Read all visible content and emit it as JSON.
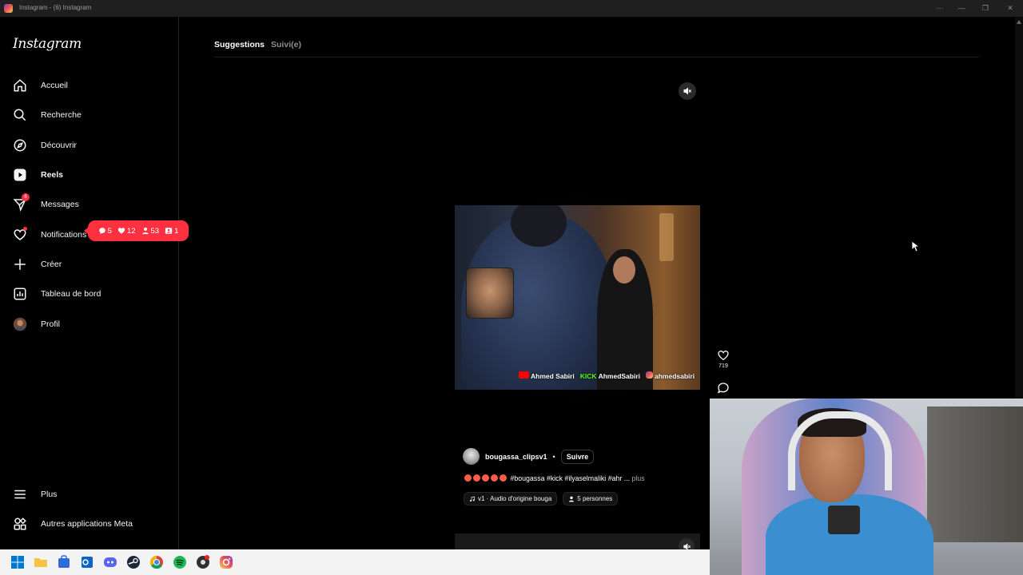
{
  "window": {
    "title": "Instagram - (6) Instagram"
  },
  "sidebar": {
    "logo": "Instagram",
    "items": [
      {
        "label": "Accueil",
        "icon": "home-icon"
      },
      {
        "label": "Recherche",
        "icon": "search-icon"
      },
      {
        "label": "Découvrir",
        "icon": "compass-icon"
      },
      {
        "label": "Reels",
        "icon": "reels-icon",
        "active": true
      },
      {
        "label": "Messages",
        "icon": "messenger-icon",
        "badge": "6"
      },
      {
        "label": "Notifications",
        "icon": "heart-icon"
      },
      {
        "label": "Créer",
        "icon": "plus-icon"
      },
      {
        "label": "Tableau de bord",
        "icon": "chart-icon"
      },
      {
        "label": "Profil",
        "icon": "avatar"
      }
    ],
    "bottom": [
      {
        "label": "Plus",
        "icon": "menu-icon"
      },
      {
        "label": "Autres applications Meta",
        "icon": "meta-apps-icon"
      }
    ]
  },
  "notifications_popup": {
    "comments": "5",
    "likes": "12",
    "followers": "53",
    "mentions": "1"
  },
  "tabs": [
    "Suggestions",
    "Suivi(e)"
  ],
  "reel": {
    "watermark": {
      "youtube": "Ahmed Sabiri",
      "kick_label": "KICK",
      "kick": "AhmedSabiri",
      "instagram": "ahmedsabiri"
    },
    "likes": "719",
    "author": "bougassa_clipsv1",
    "separator": "•",
    "follow_label": "Suivre",
    "caption": "#bougassa #kick #ilyaselmaliki #ahr ...",
    "caption_more": "plus",
    "audio": "v1 · Audio d'origine  bouga",
    "people": "5 personnes"
  },
  "taskbar": {
    "icons": [
      "windows-start-icon",
      "file-explorer-icon",
      "store-icon",
      "outlook-icon",
      "discord-icon",
      "steam-icon",
      "chrome-icon",
      "spotify-icon",
      "obs-icon",
      "instagram-icon"
    ]
  }
}
